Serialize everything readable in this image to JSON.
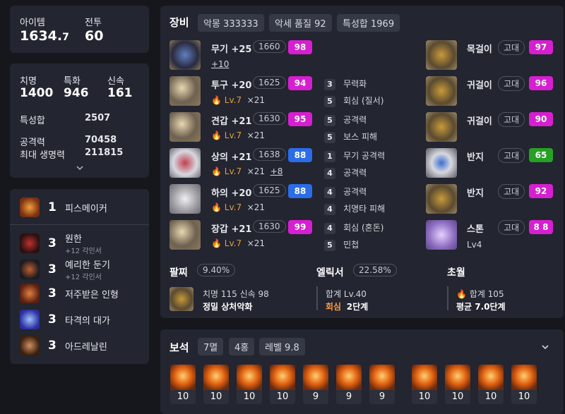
{
  "summary": {
    "item_label": "아이템",
    "item_value": "1634.",
    "item_value_small": "7",
    "combat_label": "전투",
    "combat_value": "60"
  },
  "stats": {
    "crit_label": "치명",
    "crit_value": "1400",
    "spec_label": "특화",
    "spec_value": "946",
    "swift_label": "신속",
    "swift_value": "161",
    "total_label": "특성합",
    "total_value": "2507",
    "atk_label": "공격력",
    "atk_value": "70458",
    "hp_label": "최대 생명력",
    "hp_value": "211815"
  },
  "engravings": [
    {
      "level": "1",
      "name": "피스메이커",
      "sub": ""
    },
    {
      "level": "3",
      "name": "원한",
      "sub": "+12 각인서"
    },
    {
      "level": "3",
      "name": "예리한 둔기",
      "sub": "+12 각인서"
    },
    {
      "level": "3",
      "name": "저주받은 인형",
      "sub": ""
    },
    {
      "level": "3",
      "name": "타격의 대가",
      "sub": ""
    },
    {
      "level": "3",
      "name": "아드레날린",
      "sub": ""
    }
  ],
  "equipment": {
    "title": "장비",
    "badge1": "악몽 333333",
    "badge2": "악세 품질 92",
    "badge3": "특성합 1969",
    "gear": [
      {
        "name": "무기 +25",
        "il": "1660",
        "q": "98",
        "qc": "m",
        "sub1": "",
        "sub2": "",
        "extra": "+10",
        "e1n": "",
        "e1": "",
        "e2n": "",
        "e2": ""
      },
      {
        "name": "투구 +20",
        "il": "1625",
        "q": "94",
        "qc": "m",
        "sub1": "Lv.7",
        "sub2": "×21",
        "extra": "",
        "e1n": "3",
        "e1": "무력화",
        "e2n": "5",
        "e2": "회심 (질서)"
      },
      {
        "name": "견갑 +21",
        "il": "1630",
        "q": "95",
        "qc": "m",
        "sub1": "Lv.7",
        "sub2": "×21",
        "extra": "",
        "e1n": "5",
        "e1": "공격력",
        "e2n": "5",
        "e2": "보스 피해"
      },
      {
        "name": "상의 +21",
        "il": "1638",
        "q": "88",
        "qc": "b",
        "sub1": "Lv.7",
        "sub2": "×21",
        "extra": "+8",
        "e1n": "1",
        "e1": "무기 공격력",
        "e2n": "4",
        "e2": "공격력"
      },
      {
        "name": "하의 +20",
        "il": "1625",
        "q": "88",
        "qc": "b",
        "sub1": "Lv.7",
        "sub2": "×21",
        "extra": "",
        "e1n": "4",
        "e1": "공격력",
        "e2n": "4",
        "e2": "치명타 피해"
      },
      {
        "name": "장갑 +21",
        "il": "1630",
        "q": "99",
        "qc": "m",
        "sub1": "Lv.7",
        "sub2": "×21",
        "extra": "",
        "e1n": "4",
        "e1": "회심 (혼돈)",
        "e2n": "5",
        "e2": "민첩"
      }
    ],
    "acc": [
      {
        "name": "목걸이",
        "grade": "고대",
        "q": "97",
        "qc": "m"
      },
      {
        "name": "귀걸이",
        "grade": "고대",
        "q": "96",
        "qc": "m"
      },
      {
        "name": "귀걸이",
        "grade": "고대",
        "q": "90",
        "qc": "m"
      },
      {
        "name": "반지",
        "grade": "고대",
        "q": "65",
        "qc": "g"
      },
      {
        "name": "반지",
        "grade": "고대",
        "q": "92",
        "qc": "m"
      },
      {
        "name": "스톤",
        "grade": "고대",
        "q": "8 8",
        "qc": "m",
        "sub": "Lv4"
      }
    ]
  },
  "bracelet": {
    "title": "팔찌",
    "pct": "9.40%",
    "l1": "치명 115  신속 98",
    "l2": "정밀  상처악화"
  },
  "elixir": {
    "title": "엘릭서",
    "pct": "22.58%",
    "l1": "합계 Lv.40",
    "l2a": "회심",
    "l2b": "2단계"
  },
  "transcend": {
    "title": "초월",
    "l1": "합계 105",
    "l2": "평균 7.0단계"
  },
  "gems": {
    "title": "보석",
    "b1": "7멸",
    "b2": "4홍",
    "b3": "레벨 9.8",
    "values": [
      "10",
      "10",
      "10",
      "10",
      "9",
      "9",
      "9",
      "10",
      "10",
      "10",
      "10"
    ]
  },
  "colors": {
    "magenta": "#d61fd0",
    "blue": "#2b6de8",
    "green": "#26a124"
  }
}
